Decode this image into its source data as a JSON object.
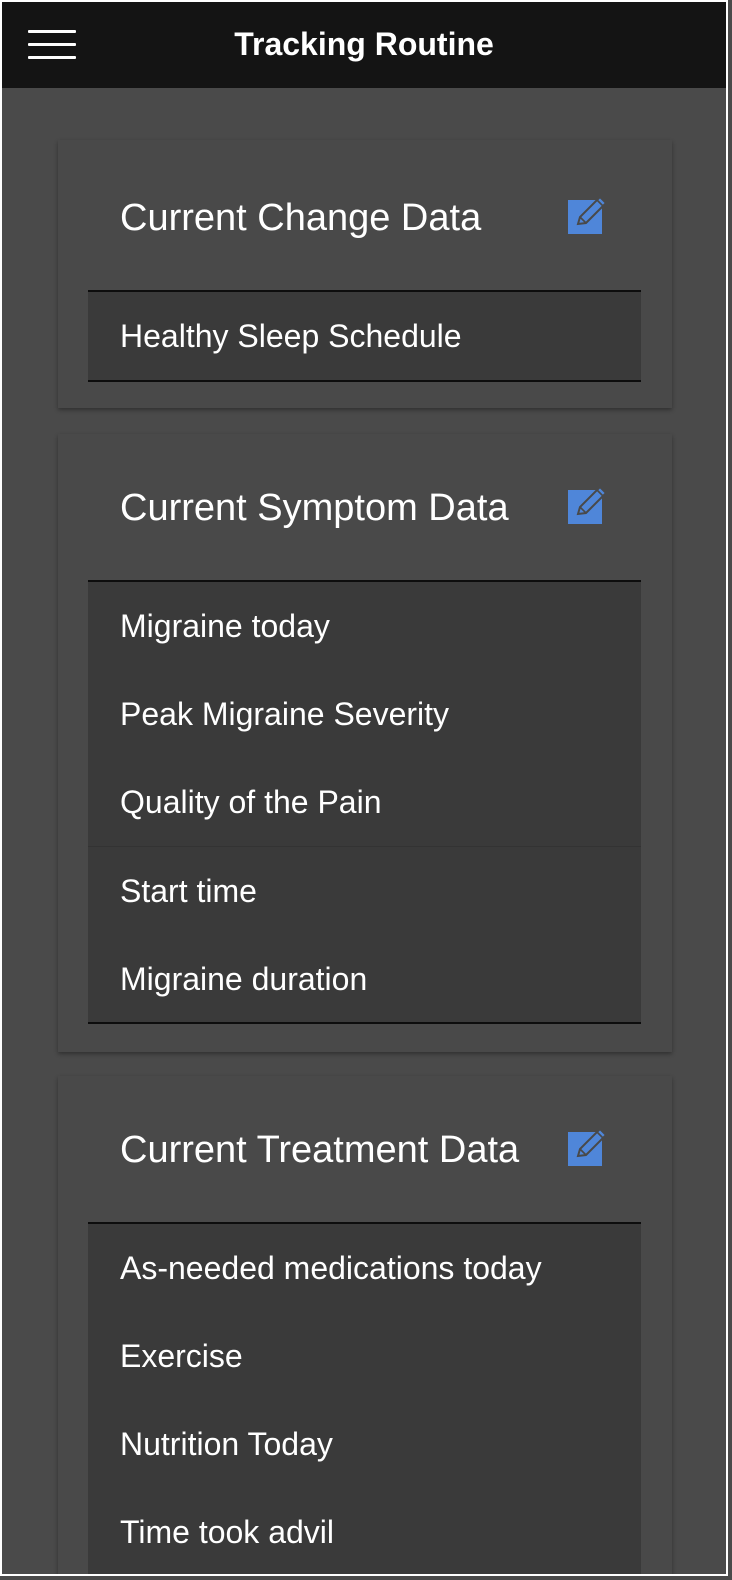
{
  "header": {
    "title": "Tracking Routine",
    "menu_icon": "hamburger-menu-icon"
  },
  "accent_color": "#4f86d9",
  "cards": [
    {
      "title": "Current Change Data",
      "edit_icon": "edit-icon",
      "items": [
        "Healthy Sleep Schedule"
      ]
    },
    {
      "title": "Current Symptom Data",
      "edit_icon": "edit-icon",
      "items": [
        "Migraine today",
        "Peak Migraine Severity",
        "Quality of the Pain",
        "Start time",
        "Migraine duration"
      ]
    },
    {
      "title": "Current Treatment Data",
      "edit_icon": "edit-icon",
      "items": [
        "As-needed medications today",
        "Exercise",
        "Nutrition Today",
        "Time took advil"
      ]
    }
  ]
}
